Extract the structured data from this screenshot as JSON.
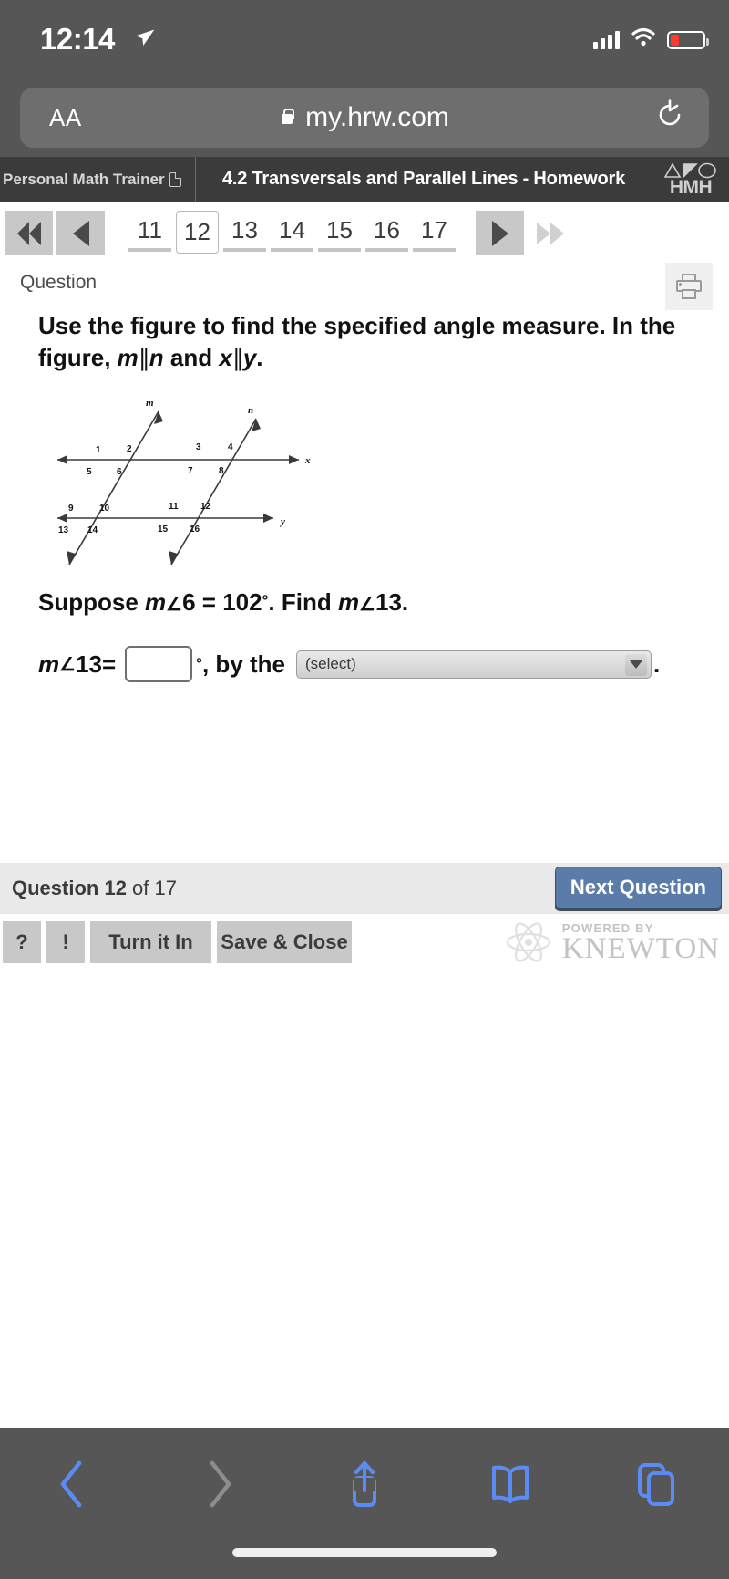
{
  "status_bar": {
    "time": "12:14",
    "location_icon": "location-arrow-icon",
    "signal_icon": "cellular-signal-icon",
    "wifi_icon": "wifi-icon",
    "battery_icon": "battery-low-icon",
    "battery_color": "#ff3b30"
  },
  "browser": {
    "text_size_label": "AA",
    "lock_icon": "lock-icon",
    "url": "my.hrw.com",
    "reload_icon": "reload-icon",
    "chrome_color": "#565656",
    "bottom_bar": {
      "back_icon": "chevron-left-icon",
      "forward_icon": "chevron-right-icon",
      "share_icon": "share-icon",
      "bookmarks_icon": "book-icon",
      "tabs_icon": "tabs-icon",
      "back_enabled": true,
      "forward_enabled": false,
      "accent_color": "#5b8cf5"
    }
  },
  "app_header": {
    "brand": "Personal Math Trainer",
    "brand_icon": "document-icon",
    "title": "4.2 Transversals and Parallel Lines - Homework",
    "logo_word": "HMH",
    "logo_icon": "hmh-logo-icon",
    "bar_color": "#3b3b3b"
  },
  "pager": {
    "first_icon": "double-chevron-left-icon",
    "prev_icon": "chevron-left-icon",
    "next_icon": "chevron-right-icon",
    "last_icon": "double-chevron-right-icon",
    "pages": [
      "11",
      "12",
      "13",
      "14",
      "15",
      "16",
      "17"
    ],
    "current_page": "12"
  },
  "question_panel": {
    "label": "Question",
    "print_icon": "printer-icon",
    "stem_line1": "Use the figure to find the specified angle measure. In the",
    "stem_line2_prefix": "figure, ",
    "stem_var_m": "m",
    "stem_parallel1": "∥",
    "stem_var_n": "n",
    "stem_and": " and ",
    "stem_var_x": "x",
    "stem_parallel2": "∥",
    "stem_var_y": "y",
    "stem_period": ".",
    "suppose_prefix": "Suppose ",
    "suppose_m": "m",
    "suppose_angle_symbol": "∠",
    "suppose_angle_num": "6",
    "suppose_equals": " = ",
    "suppose_value": "102",
    "suppose_degree": "°",
    "suppose_find": ". Find ",
    "find_m": "m",
    "find_angle_symbol": "∠",
    "find_angle_num": "13",
    "find_period": "."
  },
  "answer_row": {
    "label_m": "m",
    "label_angle": "∠",
    "label_num": "13",
    "label_equals": " = ",
    "input_value": "",
    "input_placeholder": "",
    "degree": "°",
    "by_the": ", by the",
    "select_value": "(select)",
    "select_arrow_icon": "chevron-down-icon",
    "trailing_period": "."
  },
  "footer": {
    "status_prefix": "Question ",
    "status_current": "12",
    "status_of": " of ",
    "status_total": "17",
    "next_button": "Next Question",
    "next_button_color": "#5b7ca8",
    "help_button": "?",
    "alert_button": "!",
    "turn_in_button": "Turn it In",
    "save_close_button": "Save & Close",
    "powered_by": "POWERED BY",
    "brand": "KNEWTON",
    "atom_icon": "atom-icon"
  },
  "figure": {
    "type": "geometry-diagram",
    "description": "Two parallel horizontal lines x and y cut by two parallel transversals m and n, forming 16 numbered angles.",
    "line_labels": [
      "m",
      "n",
      "x",
      "y"
    ],
    "angle_numbers": [
      "1",
      "2",
      "3",
      "4",
      "5",
      "6",
      "7",
      "8",
      "9",
      "10",
      "11",
      "12",
      "13",
      "14",
      "15",
      "16"
    ],
    "top_line_label": "x",
    "bottom_line_label": "y",
    "left_transversal_label": "m",
    "right_transversal_label": "n",
    "angles_above_x": [
      "1",
      "2",
      "3",
      "4"
    ],
    "angles_below_x": [
      "5",
      "6",
      "7",
      "8"
    ],
    "angles_above_y": [
      "9",
      "10",
      "11",
      "12"
    ],
    "angles_below_y": [
      "13",
      "14",
      "15",
      "16"
    ]
  }
}
